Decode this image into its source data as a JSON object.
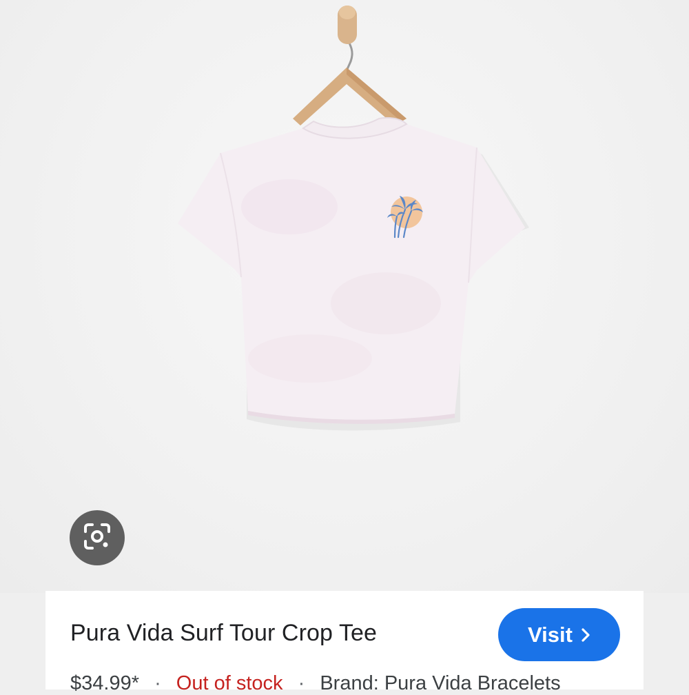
{
  "product": {
    "title": "Pura Vida Surf Tour Crop Tee",
    "price": "$34.99*",
    "stock_status": "Out of stock",
    "brand": "Brand: Pura Vida Bracelets",
    "separator": "·"
  },
  "actions": {
    "visit_label": "Visit"
  },
  "colors": {
    "accent": "#1a73e8",
    "out_of_stock": "#c5221f",
    "lens_button": "#5f5f5f"
  },
  "icons": {
    "lens": "google-lens-icon",
    "visit_chevron": "chevron-right-icon"
  }
}
